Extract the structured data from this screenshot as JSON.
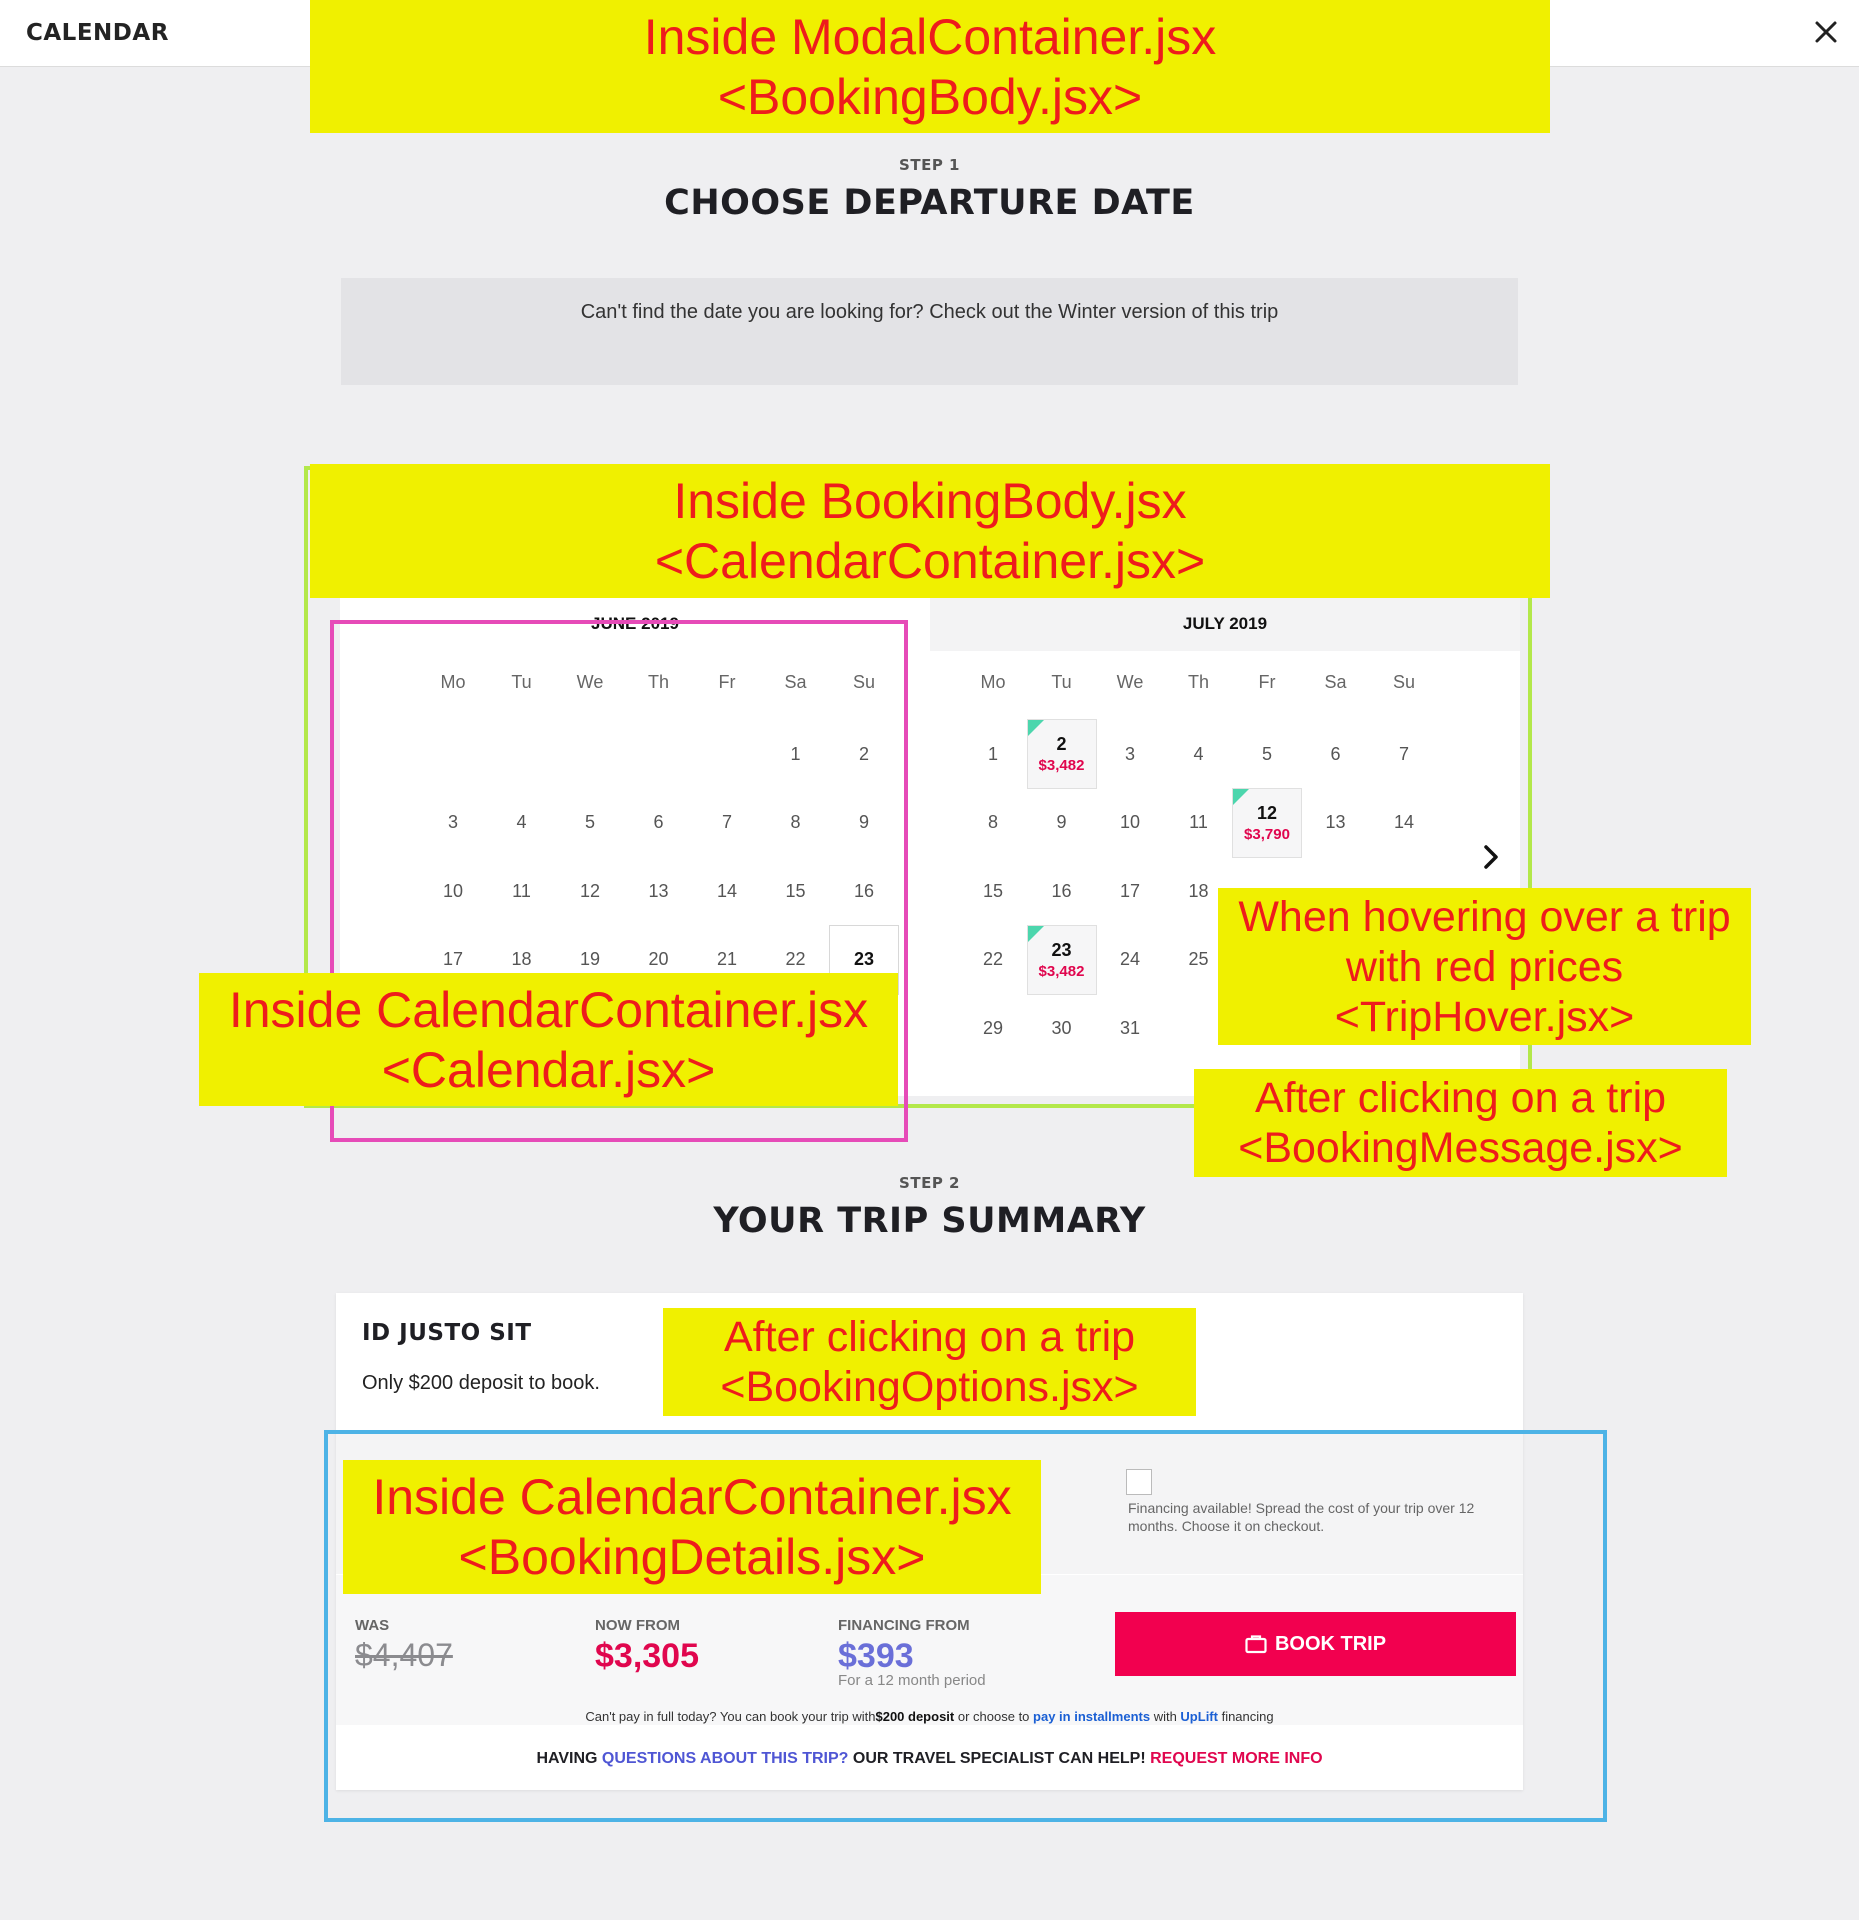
{
  "header": {
    "title": "CALENDAR",
    "close_icon": "close-icon"
  },
  "step1": {
    "label": "STEP 1",
    "title": "CHOOSE DEPARTURE DATE"
  },
  "notice": {
    "text": "Can't find the date you are looking for? Check out the Winter version of this trip"
  },
  "calendar": {
    "weekdays": [
      "Mo",
      "Tu",
      "We",
      "Th",
      "Fr",
      "Sa",
      "Su"
    ],
    "june": {
      "label": "JUNE 2019",
      "days": [
        "1",
        "2",
        "3",
        "4",
        "5",
        "6",
        "7",
        "8",
        "9",
        "10",
        "11",
        "12",
        "13",
        "14",
        "15",
        "16",
        "17",
        "18",
        "19",
        "20",
        "21",
        "22",
        "23"
      ]
    },
    "july": {
      "label": "JULY 2019",
      "days": [
        "1",
        "2",
        "3",
        "4",
        "5",
        "6",
        "7",
        "8",
        "9",
        "10",
        "11",
        "12",
        "13",
        "14",
        "15",
        "16",
        "17",
        "18",
        "22",
        "23",
        "24",
        "25",
        "29",
        "30",
        "31"
      ],
      "trips": {
        "2": "$3,482",
        "12": "$3,790",
        "23": "$3,482"
      }
    },
    "next_icon": "chevron-right-icon",
    "trip_corner_color": "#4cd6ad",
    "price_color": "#e0064e"
  },
  "step2": {
    "label": "STEP 2",
    "title": "YOUR TRIP SUMMARY"
  },
  "summary": {
    "trip_name": "ID JUSTO SIT",
    "deposit_text": "Only $200 deposit to book.",
    "financing_note": "Financing available! Spread the cost of your trip over 12 months. Choose it on checkout.",
    "was_label": "WAS",
    "was_value": "$4,407",
    "now_label": "NOW FROM",
    "now_value": "$3,305",
    "financing_label": "FINANCING FROM",
    "financing_value": "$393",
    "financing_period": "For a 12 month period",
    "book_button": "BOOK TRIP",
    "book_icon": "briefcase-icon",
    "inst_a": "Can't pay in full today? You can book your trip with",
    "inst_deposit": "$200 deposit",
    "inst_b": " or choose to ",
    "inst_link": "pay in installments",
    "inst_c": " with ",
    "inst_uplift": "UpLift",
    "inst_d": " financing",
    "q_a": "HAVING ",
    "q_link": "QUESTIONS ABOUT THIS TRIP?",
    "q_b": " OUR TRAVEL SPECIALIST CAN HELP! ",
    "q_request": "REQUEST MORE INFO"
  },
  "annotations": {
    "modal": {
      "line1": "Inside ModalContainer.jsx",
      "line2": "<BookingBody.jsx>"
    },
    "booking_body": {
      "line1": "Inside BookingBody.jsx",
      "line2": "<CalendarContainer.jsx>"
    },
    "calendar": {
      "line1": "Inside CalendarContainer.jsx",
      "line2": "<Calendar.jsx>"
    },
    "trip_hover": {
      "line1": "When hovering over a trip",
      "line2": "with red prices",
      "line3": "<TripHover.jsx>"
    },
    "booking_message": {
      "line1": "After clicking on a trip",
      "line2": "<BookingMessage.jsx>"
    },
    "booking_options": {
      "line1": "After clicking on a trip",
      "line2": "<BookingOptions.jsx>"
    },
    "booking_details": {
      "line1": "Inside CalendarContainer.jsx",
      "line2": "<BookingDetails.jsx>"
    },
    "colors": {
      "highlight": "#f0f000",
      "text": "#ee1c1c",
      "green_frame": "#b3e84a",
      "pink_frame": "#e64bb8",
      "blue_frame": "#4db3e6"
    }
  }
}
